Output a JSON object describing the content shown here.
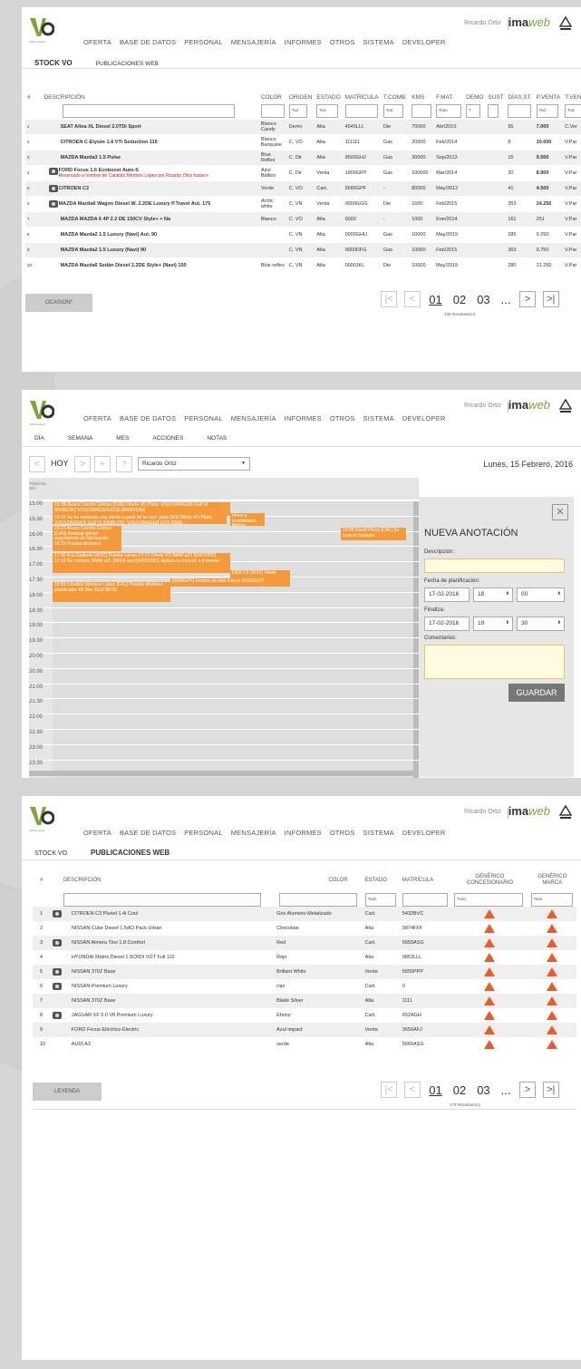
{
  "brand": {
    "logo_text": "VO",
    "logo_sub": "CMA Imaweb",
    "user": "Ricardo Ortiz",
    "name_a": "ima",
    "name_b": "web",
    "accent": "#f39a3c",
    "warn": "#ea5d2b"
  },
  "nav": [
    "OFERTA",
    "BASE DE DATOS",
    "PERSONAL",
    "MENSAJERÍA",
    "INFORMES",
    "OTROS",
    "SISTEMA",
    "DEVELOPER"
  ],
  "s1": {
    "subnav": [
      "STOCK VO",
      "PUBLICACIONES WEB"
    ],
    "headers": [
      "#",
      "DESCRIPCIÓN",
      "COLOR",
      "ORIGEN",
      "ESTADO",
      "MATRÍCULA",
      "T.COMB.",
      "KMS",
      "F.MAT.",
      "DEMO",
      "SUST",
      "DÍAS.ST.",
      "P.VENTA",
      "T.VEN"
    ],
    "filters": {
      "tod": "Tod",
      "todo": "Todo",
      "t": "T"
    },
    "rows": [
      {
        "n": "1",
        "d": "SEAT Altea XL Diesel 2.0TDi Sport",
        "c": "Blanco Candy",
        "o": "Demo",
        "e": "Alta",
        "m": "4545LLL",
        "f": "Die",
        "k": "70000",
        "fm": "Abr/2010",
        "ds": "95",
        "p": "7.000",
        "tv": "C.Ver",
        "cam": false,
        "note": ""
      },
      {
        "n": "2",
        "d": "CITROEN C-Elysée 1.6 VTi Seduction 115",
        "c": "Blanco Banquise",
        "o": "C. VO",
        "e": "Alta",
        "m": "111111",
        "f": "Gas",
        "k": "20000",
        "fm": "Feb/2014",
        "ds": "8",
        "p": "10.000",
        "tv": "V.Par",
        "cam": false,
        "note": ""
      },
      {
        "n": "3",
        "d": "MAZDA Mazda3 1.5 Pulse",
        "c": "Blue Reflex",
        "o": "C. Dir",
        "e": "Alta",
        "m": "9500GHJ",
        "f": "Gas",
        "k": "30000",
        "fm": "Sep/2013",
        "ds": "15",
        "p": "9.500",
        "tv": "V.Par",
        "cam": false,
        "note": ""
      },
      {
        "n": "4",
        "d": "FORD Focus 1.6 Ecoboost Auto-S",
        "c": "Azul Báltico",
        "o": "C. Dir",
        "e": "Venta",
        "m": "1900GRY",
        "f": "Gas",
        "k": "100000",
        "fm": "Mar/2014",
        "ds": "20",
        "p": "8.900",
        "tv": "V.Par",
        "cam": true,
        "note": "Reservado a nombre de Candido Montero López por Ricardo Ortiz hasta e"
      },
      {
        "n": "5",
        "d": "CITROEN C3",
        "c": "Verde",
        "o": "C. VO",
        "e": "Cart.",
        "m": "5689GPF",
        "f": "-",
        "k": "80000",
        "fm": "May/2012",
        "ds": "41",
        "p": "4.500",
        "tv": "V.Par",
        "cam": true,
        "note": ""
      },
      {
        "n": "6",
        "d": "MAZDA Mazda6 Wagon Diesel W. 2.2DE Luxury P.Travel Aut. 175",
        "c": "Arctic white",
        "o": "C. VN",
        "e": "Venta",
        "m": "0000GGG",
        "f": "Die",
        "k": "1000",
        "fm": "Feb/2015",
        "ds": "353",
        "p": "24.250",
        "tv": "V.Par",
        "cam": true,
        "note": ""
      },
      {
        "n": "7",
        "d": "MAZDA MAZDA 6 4P 2.2 DE 150CV Style+ + Na",
        "c": "Blanco",
        "o": "C. VO",
        "e": "Alta",
        "m": "0000",
        "f": "-",
        "k": "1000",
        "fm": "Ene/2014",
        "ds": "161",
        "p": "251",
        "tv": "V.Par",
        "cam": false,
        "note": ""
      },
      {
        "n": "8",
        "d": "MAZDA Mazda2 1.5 Luxury (Navi) Aut. 90",
        "c": "",
        "o": "C. VN",
        "e": "Alta",
        "m": "0000GHU",
        "f": "Gas",
        "k": "10000",
        "fm": "May/2015",
        "ds": "285",
        "p": "9.250",
        "tv": "V.Par",
        "cam": false,
        "note": ""
      },
      {
        "n": "9",
        "d": "MAZDA Mazda2 1.5 Luxury (Navi) 90",
        "c": "",
        "o": "C. VN",
        "e": "Alta",
        "m": "0000DFG",
        "f": "Gas",
        "k": "10000",
        "fm": "Feb/2015",
        "ds": "363",
        "p": "9.750",
        "tv": "V.Par",
        "cam": false,
        "note": ""
      },
      {
        "n": "10",
        "d": "MAZDA Mazda6 Sedán Diesel 2.2DE Style+ (Navi) 150",
        "c": "Blue reflex",
        "o": "C. VN",
        "e": "Alta",
        "m": "0000JKL",
        "f": "Die",
        "k": "10000",
        "fm": "May/2015",
        "ds": "280",
        "p": "21.250",
        "tv": "V.Par",
        "cam": false,
        "note": ""
      }
    ],
    "button": "OCASION*",
    "pages": [
      "01",
      "02",
      "03",
      "..."
    ],
    "results": "438 Resultado(s)"
  },
  "s2": {
    "subnav": [
      "DÍA",
      "SEMANA",
      "MES",
      "ACCIONES",
      "NOTAS"
    ],
    "today": "HOY",
    "user": "Ricardo Ortiz",
    "date": "Lunes, 15 Febrero, 2016",
    "allday": "TODO EL DÍA",
    "hours": [
      "15:00",
      "15:30",
      "16:00",
      "16:30",
      "17:00",
      "17:30",
      "18:00",
      "18:30",
      "19:00",
      "19:30",
      "20:00",
      "20:30",
      "21:00",
      "21:30",
      "22:00",
      "22:30",
      "23:00",
      "23:30"
    ],
    "events": [
      "15:38 Alvaro Carrión Gómez [CAR] Oferta VO Plata: VOLKSWAGEN Golf VI [9596LOK] VOLKSWAGEN EOS [8996KOW]",
      "15:42 Se ha realizado una oferta a partir de la conf. page [93] Oferta VO Plata: VOLKSWAGEN Golf VI [6596LOK], VOLKSWAGEN EOS [8996...",
      "rtinez a Irrtabilidado. Motivo:",
      "16:23 Alvaro Carrión Gómez [CAR] Realizar primer seguimiento de fidelización 16:29 Prueba dinámica",
      "16:08 David Pérez [CAL] Se crea el contacto",
      "17:00 Ana Gallardo [NOC] Prueba carrea 17:12 Oferta VO BMW a21 [5497DDD] 17:16 No compra: BMW a21 [2010] azul [5497DDD]. Aplaza la compra: s 6 meses",
      "DEN C3 (2012) Verde",
      "[5689GPF] compra en otra marca: PEUGEOT",
      "18:03 Cándido Montero López [CAL] Prueba dinámica planificada: 08 Mar 2016 08:00."
    ],
    "form": {
      "title": "NUEVA ANOTACIÓN",
      "desc_label": "Descripción:",
      "plan_label": "Fecha de planificación:",
      "plan_date": "17-02-2016",
      "plan_h": "18",
      "plan_m": "00",
      "end_label": "Finaliza:",
      "end_date": "17-02-2016",
      "end_h": "19",
      "end_m": "30",
      "comments_label": "Comentarios:",
      "save": "GUARDAR"
    }
  },
  "s3": {
    "subnav": [
      "STOCK VO",
      "PUBLICACIONES WEB"
    ],
    "headers": [
      "#",
      "DESCRIPCIÓN",
      "COLOR",
      "ESTADO",
      "MATRÍCULA",
      "GENÉRICO CONCESIONARIO",
      "GENÉRICO MARCA"
    ],
    "filter_todo": "Todo",
    "rows": [
      {
        "n": "1",
        "d": "CITROEN C3 Pluriel 1.4i Cool",
        "c": "Gris Aluminio Metalizado",
        "e": "Cart.",
        "m": "5432BVC",
        "cam": true
      },
      {
        "n": "2",
        "d": "NISSAN Cube Diesel 1.5dCi Pack Urban",
        "c": "Chocolate",
        "e": "Alta",
        "m": "9874FFF",
        "cam": false
      },
      {
        "n": "3",
        "d": "NISSAN Almera Tino 1.8 Comfort",
        "c": "Red",
        "e": "Cart.",
        "m": "6655ASG",
        "cam": true
      },
      {
        "n": "4",
        "d": "HYUNDAI Matrix Diesel 1.5CRDi VGT Full 110",
        "c": "Rojo",
        "e": "Alta",
        "m": "9852LLL",
        "cam": false
      },
      {
        "n": "5",
        "d": "NISSAN 370Z Base",
        "c": "Brillant White",
        "e": "Venta",
        "m": "5555PPP",
        "cam": true
      },
      {
        "n": "6",
        "d": "NISSAN Premium Luxury",
        "c": "rojo",
        "e": "Cart.",
        "m": "0",
        "cam": true
      },
      {
        "n": "7",
        "d": "NISSAN 370Z Base",
        "c": "Blade Silver",
        "e": "Alta",
        "m": "1111",
        "cam": false
      },
      {
        "n": "8",
        "d": "JAGUAR XF 5.0 V8 Premium Luxury",
        "c": "Ebony",
        "e": "Cart.",
        "m": "652AGH",
        "cam": true
      },
      {
        "n": "9",
        "d": "FORD Focus Eléctrico Electric",
        "c": "Azul impact",
        "e": "Venta",
        "m": "3656AFJ",
        "cam": false
      },
      {
        "n": "10",
        "d": "AUDI A3",
        "c": "verde",
        "e": "Alta",
        "m": "5665ASG",
        "cam": false
      }
    ],
    "button": "LEYENDA",
    "pages": [
      "01",
      "02",
      "03",
      "..."
    ],
    "results": "179 Resultado(s)"
  }
}
